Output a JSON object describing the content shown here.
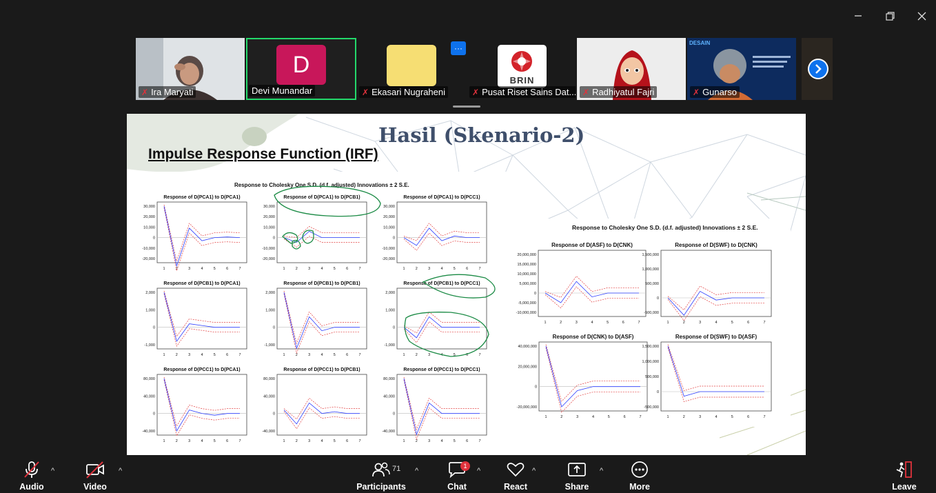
{
  "window": {
    "minimize_icon": "minimize-icon",
    "restore_icon": "restore-icon",
    "close_icon": "close-icon"
  },
  "participants_strip": {
    "tiles": [
      {
        "name": "Ira Maryati",
        "muted": true,
        "kind": "video"
      },
      {
        "name": "Devi Munandar",
        "muted": false,
        "kind": "avatar",
        "initial": "D",
        "avatar_color": "#c8175a",
        "active_speaker": true
      },
      {
        "name": "Ekasari Nugraheni",
        "muted": true,
        "kind": "avatar",
        "avatar_color": "#f6de73"
      },
      {
        "name": "Pusat Riset Sains Dat...",
        "muted": true,
        "kind": "logo",
        "logo_text": "BRIN"
      },
      {
        "name": "Radhiyatul Fajri",
        "muted": true,
        "kind": "video"
      },
      {
        "name": "Gunarso",
        "muted": true,
        "kind": "video",
        "poster_text": "DESAIN"
      }
    ],
    "more_icon": "ellipsis-icon",
    "next_icon": "chevron-right-icon"
  },
  "slide": {
    "title": "Hasil (Skenario-2)",
    "subtitle": "Impulse Response Function (IRF)",
    "left_heading": "Response to Cholesky One S.D. (d.f. adjusted) Innovations ± 2 S.E.",
    "right_heading": "Response to Cholesky One S.D. (d.f. adjusted) Innovations ± 2 S.E.",
    "x_ticks": [
      "1",
      "2",
      "3",
      "4",
      "5",
      "6",
      "7"
    ],
    "left_charts": [
      {
        "title": "Response of D(PCA1) to D(PCA1)",
        "yticks": [
          "30,000",
          "20,000",
          "10,000",
          "0",
          "-10,000",
          "-20,000"
        ]
      },
      {
        "title": "Response of D(PCA1) to D(PCB1)",
        "yticks": [
          "30,000",
          "20,000",
          "10,000",
          "0",
          "-10,000",
          "-20,000"
        ]
      },
      {
        "title": "Response of D(PCA1) to D(PCC1)",
        "yticks": [
          "30,000",
          "20,000",
          "10,000",
          "0",
          "-10,000",
          "-20,000"
        ]
      },
      {
        "title": "Response of D(PCB1) to D(PCA1)",
        "yticks": [
          "2,000",
          "1,000",
          "0",
          "-1,000"
        ]
      },
      {
        "title": "Response of D(PCB1) to D(PCB1)",
        "yticks": [
          "2,000",
          "1,000",
          "0",
          "-1,000"
        ]
      },
      {
        "title": "Response of D(PCB1) to D(PCC1)",
        "yticks": [
          "2,000",
          "1,000",
          "0",
          "-1,000"
        ]
      },
      {
        "title": "Response of D(PCC1) to D(PCA1)",
        "yticks": [
          "80,000",
          "40,000",
          "0",
          "-40,000"
        ]
      },
      {
        "title": "Response of D(PCC1) to D(PCB1)",
        "yticks": [
          "80,000",
          "40,000",
          "0",
          "-40,000"
        ]
      },
      {
        "title": "Response of D(PCC1) to D(PCC1)",
        "yticks": [
          "80,000",
          "40,000",
          "0",
          "-40,000"
        ]
      }
    ],
    "right_charts": [
      {
        "title": "Response of D(ASF) to D(CNK)",
        "yticks": [
          "20,000,000",
          "15,000,000",
          "10,000,000",
          "5,000,000",
          "0",
          "-5,000,000",
          "-10,000,000"
        ]
      },
      {
        "title": "Response of D(SWF) to D(CNK)",
        "yticks": [
          "1,500,000",
          "1,000,000",
          "500,000",
          "0",
          "-500,000"
        ]
      },
      {
        "title": "Response of D(CNK) to D(ASF)",
        "yticks": [
          "40,000,000",
          "20,000,000",
          "0",
          "-20,000,000"
        ]
      },
      {
        "title": "Response of D(SWF) to D(ASF)",
        "yticks": [
          "1,500,000",
          "1,000,000",
          "500,000",
          "0",
          "-500,000"
        ]
      }
    ]
  },
  "toolbar": {
    "audio": {
      "label": "Audio",
      "icon": "mic-muted-icon"
    },
    "video": {
      "label": "Video",
      "icon": "video-off-icon"
    },
    "participants": {
      "label": "Participants",
      "count": "71",
      "icon": "participants-icon"
    },
    "chat": {
      "label": "Chat",
      "badge": "1",
      "icon": "chat-icon"
    },
    "react": {
      "label": "React",
      "icon": "heart-icon"
    },
    "share": {
      "label": "Share",
      "icon": "share-screen-icon"
    },
    "more": {
      "label": "More",
      "icon": "more-icon"
    },
    "leave": {
      "label": "Leave",
      "icon": "leave-icon",
      "color": "#e0323c"
    }
  }
}
